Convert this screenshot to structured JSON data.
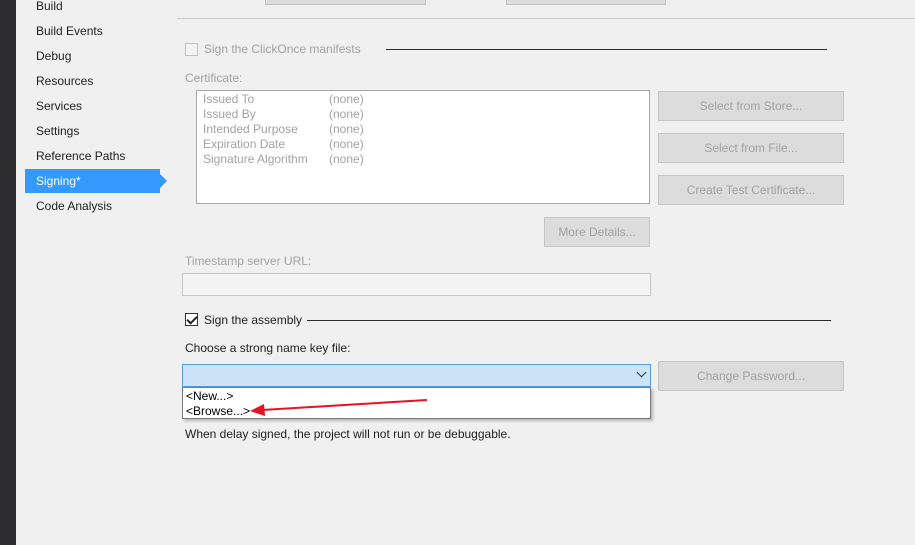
{
  "nav": {
    "items": [
      {
        "label": "Build"
      },
      {
        "label": "Build Events"
      },
      {
        "label": "Debug"
      },
      {
        "label": "Resources"
      },
      {
        "label": "Services"
      },
      {
        "label": "Settings"
      },
      {
        "label": "Reference Paths"
      },
      {
        "label": "Signing*"
      },
      {
        "label": "Code Analysis"
      }
    ],
    "selected_index": 7
  },
  "clickonce": {
    "checkbox_label": "Sign the ClickOnce manifests",
    "checked": false
  },
  "certificate": {
    "label": "Certificate:",
    "rows": [
      {
        "name": "Issued To",
        "value": "(none)"
      },
      {
        "name": "Issued By",
        "value": "(none)"
      },
      {
        "name": "Intended Purpose",
        "value": "(none)"
      },
      {
        "name": "Expiration Date",
        "value": "(none)"
      },
      {
        "name": "Signature Algorithm",
        "value": "(none)"
      }
    ],
    "buttons": {
      "select_from_store": "Select from Store...",
      "select_from_file": "Select from File...",
      "create_test": "Create Test Certificate...",
      "more_details": "More Details..."
    }
  },
  "timestamp": {
    "label": "Timestamp server URL:",
    "value": ""
  },
  "assembly": {
    "checkbox_label": "Sign the assembly",
    "checked": true,
    "key_file_label": "Choose a strong name key file:",
    "key_file_value": "",
    "dropdown_options": [
      "<New...>",
      "<Browse...>"
    ],
    "change_password": "Change Password...",
    "delay_note": "When delay signed, the project will not run or be debuggable."
  },
  "colors": {
    "accent": "#3399ff",
    "annotation_arrow": "#e81123",
    "combo_bg": "#cce4f7"
  }
}
